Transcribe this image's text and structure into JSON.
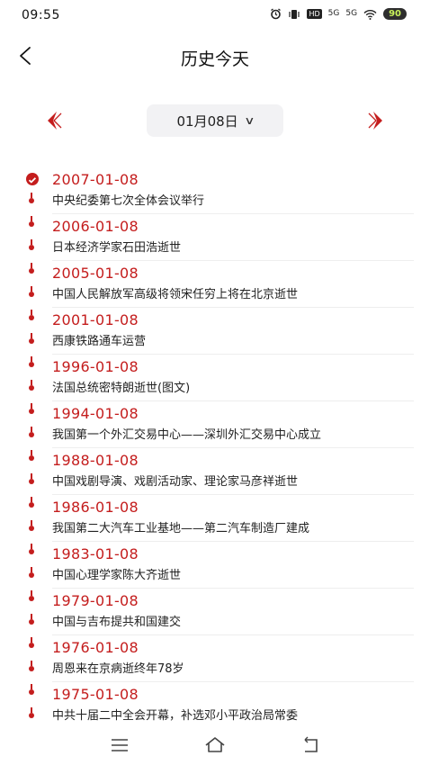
{
  "status_bar": {
    "time": "09:55",
    "icons": [
      "alarm-icon",
      "vibrate-icon",
      "hd-icon",
      "signal-5g-icon",
      "signal-5g-icon",
      "wifi-icon"
    ],
    "hd_label": "HD",
    "net1": "5G",
    "net2": "5G",
    "battery": "90"
  },
  "header": {
    "title": "历史今天"
  },
  "date_nav": {
    "selected": "01月08日",
    "chevron": "∨"
  },
  "accent": "#c41d1d",
  "events": [
    {
      "date": "2007-01-08",
      "title": "中央纪委第七次全体会议举行"
    },
    {
      "date": "2006-01-08",
      "title": "日本经济学家石田浩逝世"
    },
    {
      "date": "2005-01-08",
      "title": "中国人民解放军高级将领宋任穷上将在北京逝世"
    },
    {
      "date": "2001-01-08",
      "title": "西康铁路通车运营"
    },
    {
      "date": "1996-01-08",
      "title": "法国总统密特朗逝世(图文)"
    },
    {
      "date": "1994-01-08",
      "title": "我国第一个外汇交易中心——深圳外汇交易中心成立"
    },
    {
      "date": "1988-01-08",
      "title": "中国戏剧导演、戏剧活动家、理论家马彦祥逝世"
    },
    {
      "date": "1986-01-08",
      "title": "我国第二大汽车工业基地——第二汽车制造厂建成"
    },
    {
      "date": "1983-01-08",
      "title": "中国心理学家陈大齐逝世"
    },
    {
      "date": "1979-01-08",
      "title": "中国与吉布提共和国建交"
    },
    {
      "date": "1976-01-08",
      "title": "周恩来在京病逝终年78岁"
    },
    {
      "date": "1975-01-08",
      "title": "中共十届二中全会开幕，补选邓小平政治局常委"
    }
  ],
  "system_nav": [
    "menu-icon",
    "home-icon",
    "back-icon"
  ]
}
